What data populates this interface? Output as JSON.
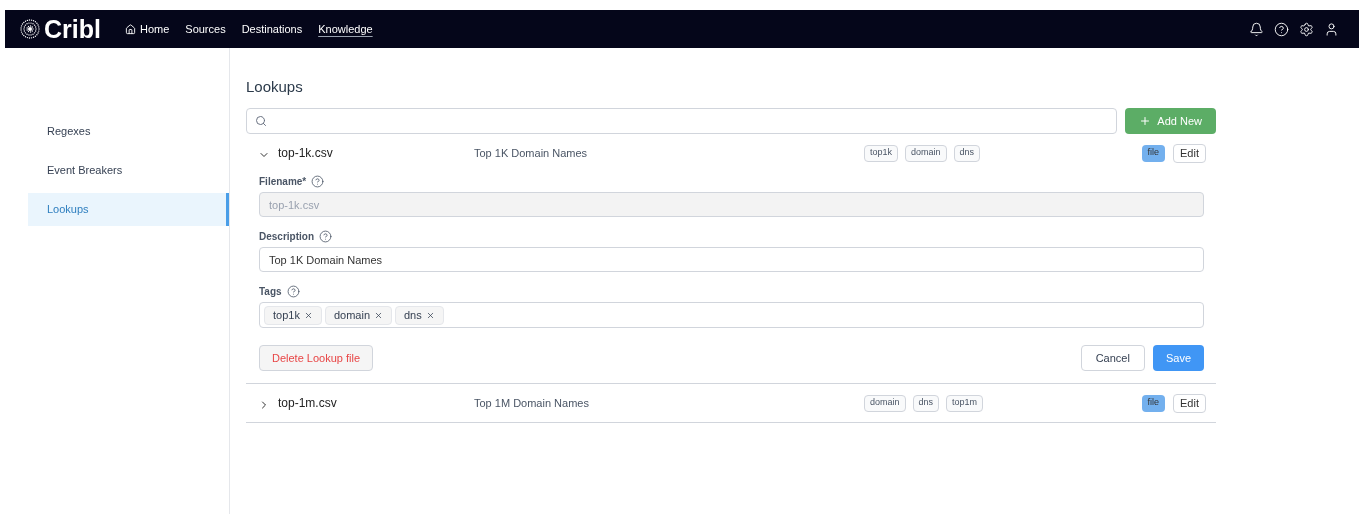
{
  "nav": {
    "brand": "Cribl",
    "items": [
      {
        "label": "Home",
        "kind": "home",
        "selected": false
      },
      {
        "label": "Sources",
        "kind": "link",
        "selected": false
      },
      {
        "label": "Destinations",
        "kind": "link",
        "selected": false
      },
      {
        "label": "Knowledge",
        "kind": "link",
        "selected": true
      }
    ]
  },
  "page_title": "Lookups",
  "sidebar": {
    "items": [
      {
        "label": "Regexes",
        "selected": false
      },
      {
        "label": "Event Breakers",
        "selected": false
      },
      {
        "label": "Lookups",
        "selected": true
      }
    ]
  },
  "add_button": "Add New",
  "lookups": [
    {
      "name": "top-1k.csv",
      "description": "Top 1K Domain Names",
      "tags": [
        "top1k",
        "domain",
        "dns"
      ],
      "type": "file",
      "edit": "Edit",
      "expanded": true,
      "form": {
        "filename_label": "Filename*",
        "filename": "top-1k.csv",
        "description_label": "Description",
        "description": "Top 1K Domain Names",
        "tags_label": "Tags",
        "tags": [
          "top1k",
          "domain",
          "dns"
        ],
        "delete": "Delete Lookup file",
        "cancel": "Cancel",
        "save": "Save"
      }
    },
    {
      "name": "top-1m.csv",
      "description": "Top 1M Domain Names",
      "tags": [
        "domain",
        "dns",
        "top1m"
      ],
      "type": "file",
      "edit": "Edit",
      "expanded": false
    }
  ]
}
